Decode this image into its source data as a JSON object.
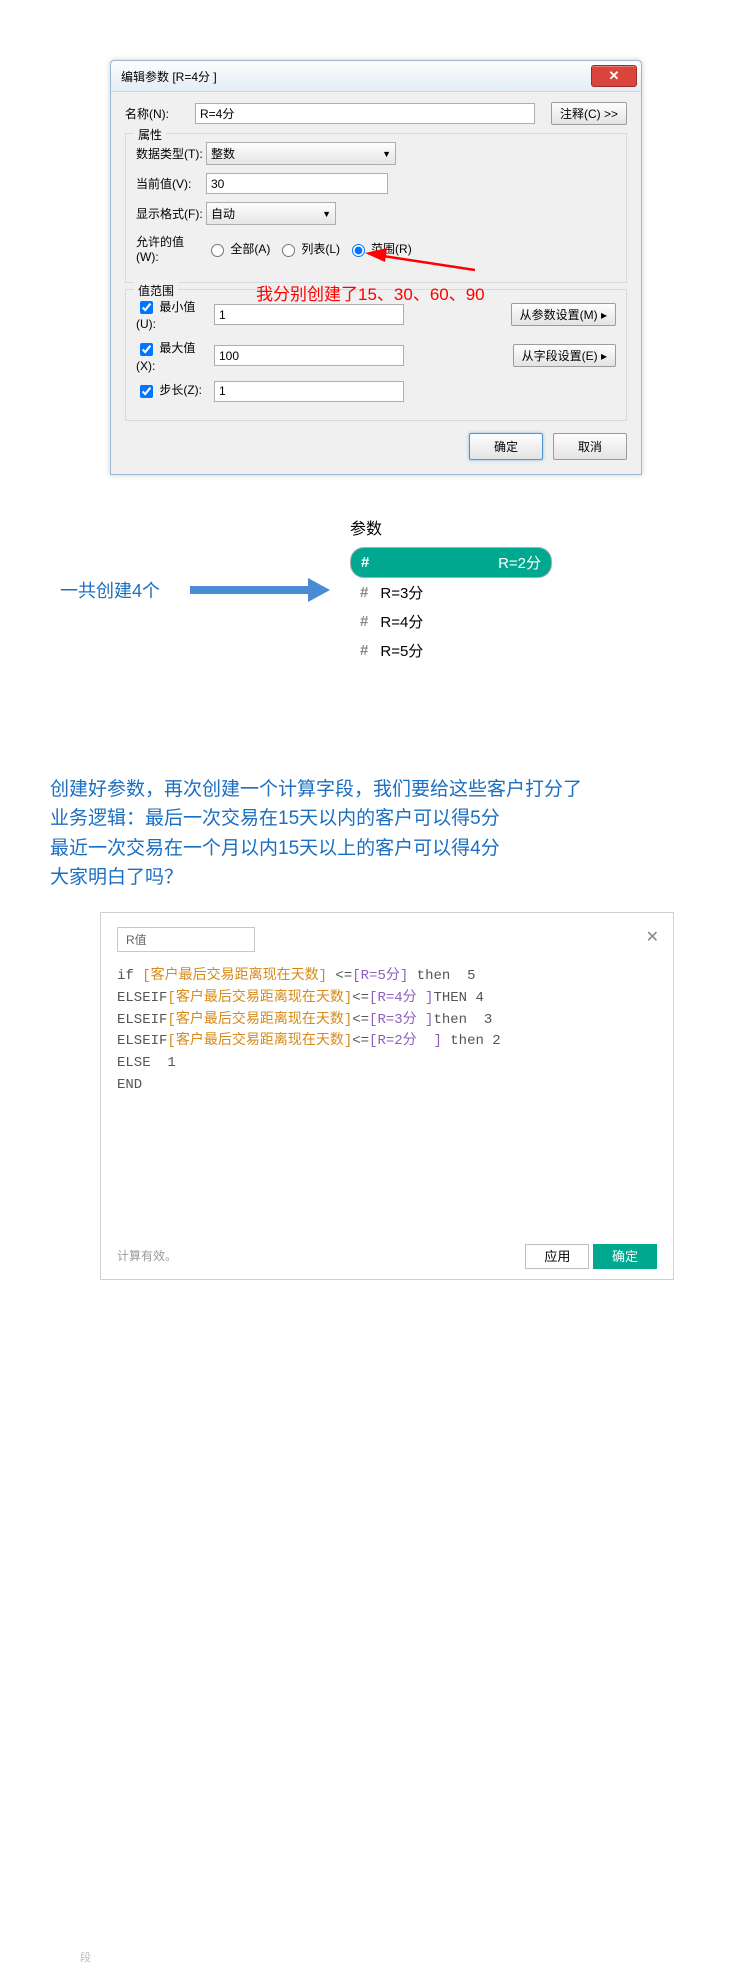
{
  "dialog": {
    "title": "编辑参数 [R=4分 ]",
    "name_label": "名称(N):",
    "name_value": "R=4分",
    "comment_btn": "注释(C) >>",
    "props_legend": "属性",
    "dtype_label": "数据类型(T):",
    "dtype_value": "整数",
    "curval_label": "当前值(V):",
    "curval_value": "30",
    "fmt_label": "显示格式(F):",
    "fmt_value": "自动",
    "allow_label": "允许的值(W):",
    "opt_all": "全部(A)",
    "opt_list": "列表(L)",
    "opt_range": "范围(R)",
    "range_legend": "值范围",
    "min_label": "最小值(U):",
    "min_value": "1",
    "max_label": "最大值(X):",
    "max_value": "100",
    "step_label": "步长(Z):",
    "step_value": "1",
    "from_param_btn": "从参数设置(M) ▸",
    "from_field_btn": "从字段设置(E) ▸",
    "ok": "确定",
    "cancel": "取消"
  },
  "red_annotation": "我分别创建了15、30、60、90",
  "created_label": "一共创建4个",
  "params": {
    "header": "参数",
    "items": [
      {
        "label": "R=2分",
        "selected": true
      },
      {
        "label": "R=3分",
        "selected": false
      },
      {
        "label": "R=4分",
        "selected": false
      },
      {
        "label": "R=5分",
        "selected": false
      }
    ]
  },
  "paragraph": {
    "l1": "创建好参数，再次创建一个计算字段，我们要给这些客户打分了",
    "l2": "业务逻辑：最后一次交易在15天以内的客户可以得5分",
    "l3": "最近一次交易在一个月以内15天以上的客户可以得4分",
    "l4": "大家明白了吗？"
  },
  "editor": {
    "name": "R值",
    "valid": "计算有效。",
    "apply": "应用",
    "ok": "确定",
    "code": {
      "lines": [
        {
          "kw": "if ",
          "field": "[客户最后交易距离现在天数]",
          "mid": " <=",
          "param": "[R=5分]",
          "rest": " then  5"
        },
        {
          "kw": "ELSEIF",
          "field": "[客户最后交易距离现在天数]",
          "mid": "<=",
          "param": "[R=4分 ]",
          "rest": "THEN 4"
        },
        {
          "kw": "ELSEIF",
          "field": "[客户最后交易距离现在天数]",
          "mid": "<=",
          "param": "[R=3分 ]",
          "rest": "then  3"
        },
        {
          "kw": "ELSEIF",
          "field": "[客户最后交易距离现在天数]",
          "mid": "<=",
          "param": "[R=2分  ]",
          "rest": " then 2"
        },
        {
          "kw": "ELSE  1"
        },
        {
          "kw": "END"
        }
      ]
    }
  },
  "margin_txt": "段"
}
